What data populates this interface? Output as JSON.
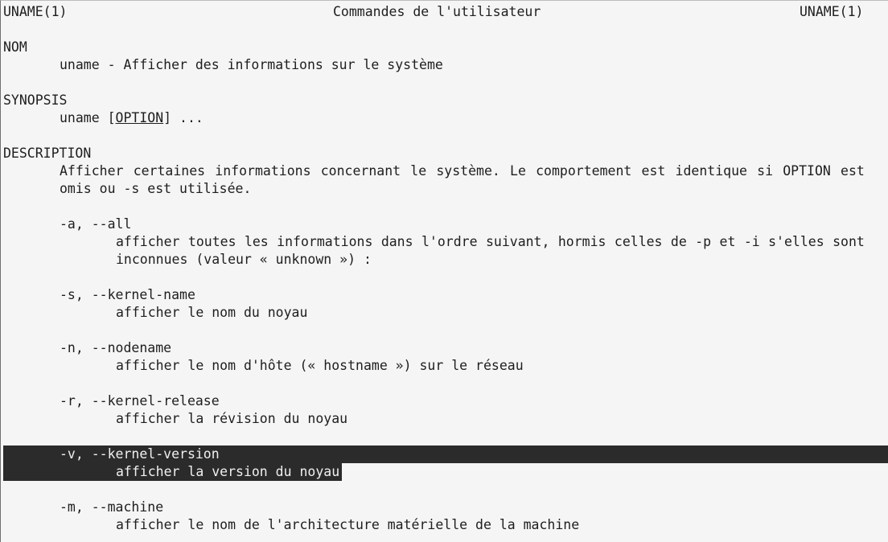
{
  "header": {
    "left": "UNAME(1)",
    "center": "Commandes de l'utilisateur",
    "right": "UNAME(1)"
  },
  "sections": {
    "nom": {
      "heading": "NOM",
      "text": "uname - Afficher des informations sur le système"
    },
    "synopsis": {
      "heading": "SYNOPSIS",
      "command": "uname",
      "bracket_open": "[",
      "option": "OPTION",
      "bracket_close_rest": "] ..."
    },
    "description": {
      "heading": "DESCRIPTION",
      "line1_words": [
        "Afficher",
        "certaines",
        "informations",
        "concernant",
        "le",
        "système.",
        "Le",
        "comportement",
        "est",
        "identique",
        "si",
        "OPTION",
        "est"
      ],
      "line2": "omis ou -s est utilisée."
    }
  },
  "options": [
    {
      "flags": "-a, --all",
      "desc_line1_words": [
        "afficher",
        "toutes",
        "les",
        "informations",
        "dans",
        "l'ordre",
        "suivant,",
        "hormis",
        "celles",
        "de",
        "-p",
        "et",
        "-i",
        "s'elles",
        "sont"
      ],
      "desc_line2": "inconnues (valeur « unknown ») :"
    },
    {
      "flags": "-s, --kernel-name",
      "desc": "afficher le nom du noyau"
    },
    {
      "flags": "-n, --nodename",
      "desc": "afficher le nom d'hôte (« hostname ») sur le réseau"
    },
    {
      "flags": "-r, --kernel-release",
      "desc": "afficher la révision du noyau"
    },
    {
      "flags": "-v, --kernel-version",
      "desc": "afficher la version du noyau"
    },
    {
      "flags": "-m, --machine",
      "desc": "afficher le nom de l'architecture matérielle de la machine"
    }
  ],
  "colors": {
    "background": "#f5f5f5",
    "text": "#1e1e1e",
    "selection_bg": "#2b2b2b",
    "selection_text": "#f0f0f0"
  }
}
